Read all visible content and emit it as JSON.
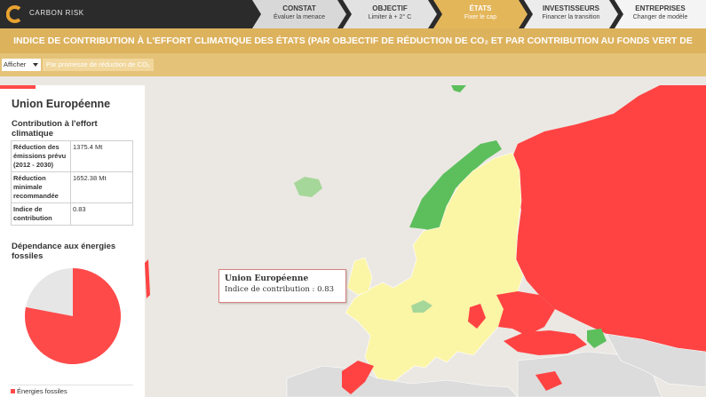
{
  "brand": {
    "name": "CARBON RISK",
    "accent": "#e8a230"
  },
  "steps": [
    {
      "title": "CONSTAT",
      "subtitle": "Évaluer la menace",
      "active": false
    },
    {
      "title": "OBJECTIF",
      "subtitle": "Limiter à + 2° C",
      "active": false
    },
    {
      "title": "ÉTATS",
      "subtitle": "Fixer le cap",
      "active": true
    },
    {
      "title": "INVESTISSEURS",
      "subtitle": "Financer la transition",
      "active": false
    },
    {
      "title": "ENTREPRISES",
      "subtitle": "Changer de modèle",
      "active": false
    }
  ],
  "banner": {
    "title": "INDICE DE CONTRIBUTION À L'EFFORT CLIMATIQUE DES ÉTATS (PAR OBJECTIF DE RÉDUCTION DE CO₂ ET PAR CONTRIBUTION AU FONDS VERT DE L'ONU)"
  },
  "filter": {
    "label": "Afficher",
    "selected": "Par promesse de réduction de CO₂"
  },
  "panel": {
    "country": "Union Européenne",
    "section1": "Contribution à l'effort climatique",
    "rows": [
      {
        "key": "Réduction des émissions prévu (2012 - 2030)",
        "value": "1375.4 Mt"
      },
      {
        "key": "Réduction minimale recommandée",
        "value": "1652.38 Mt"
      },
      {
        "key": "Indice de contribution",
        "value": "0.83"
      }
    ],
    "section2": "Dépendance aux énergies fossiles",
    "fossil_share": 0.78,
    "legend": "Énergies fossiles"
  },
  "tooltip": {
    "title": "Union Européenne",
    "text": "Indice de contribution : 0.83"
  },
  "colors": {
    "high": "#ff4343",
    "eu": "#fbf5a6",
    "good": "#5cbf5c",
    "neutral": "#dcdcdc",
    "banner": "#ddb25d"
  }
}
